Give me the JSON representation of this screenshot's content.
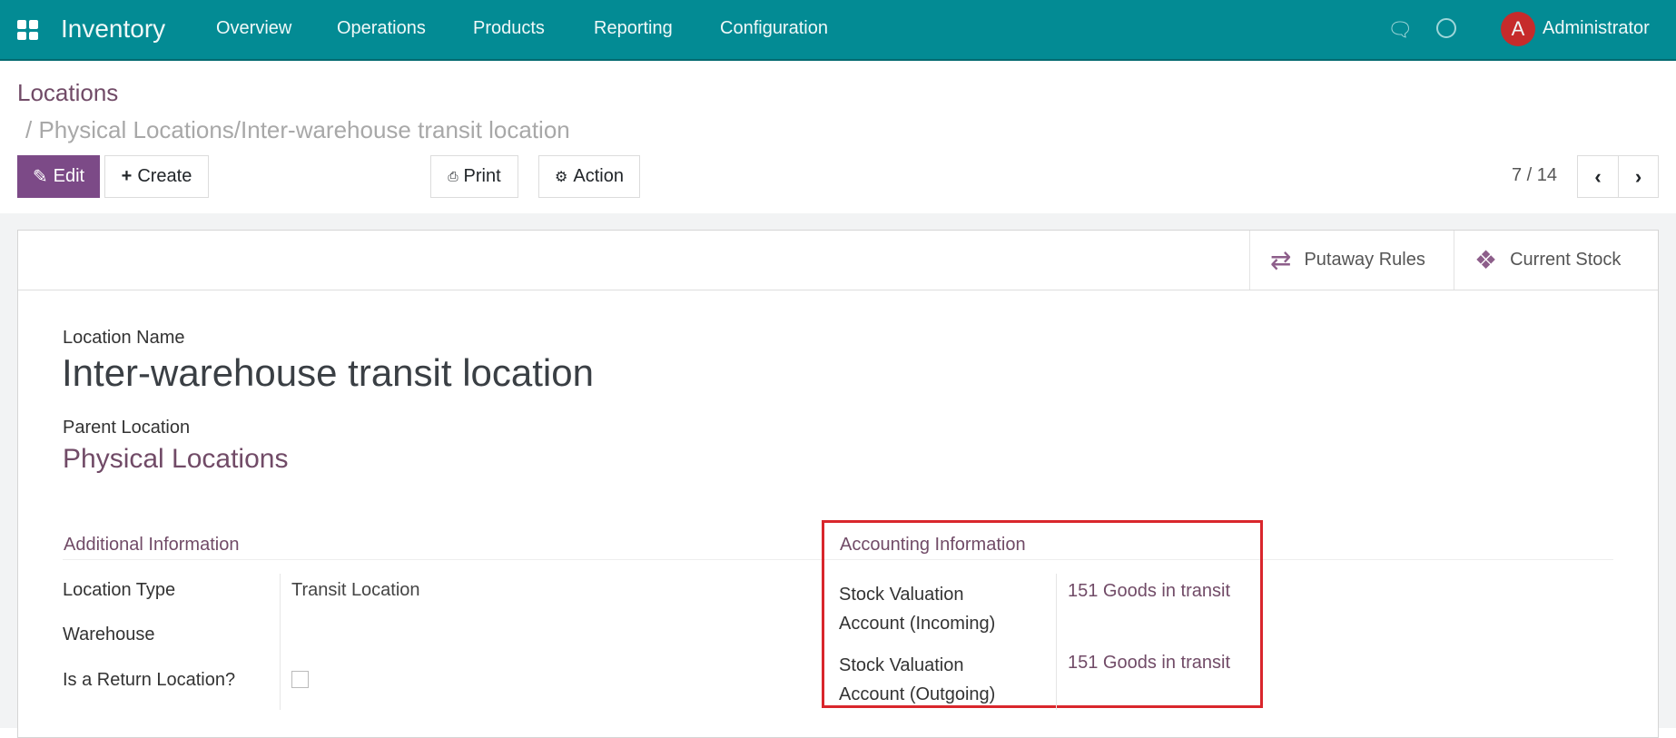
{
  "navbar": {
    "app_name": "Inventory",
    "menu": [
      "Overview",
      "Operations",
      "Products",
      "Reporting",
      "Configuration"
    ],
    "user": "Administrator",
    "avatar_letter": "A"
  },
  "breadcrumb": {
    "root": "Locations",
    "current": "/ Physical Locations/Inter-warehouse transit location"
  },
  "toolbar": {
    "edit": "Edit",
    "create": "Create",
    "print": "Print",
    "action": "Action",
    "pager": "7 / 14"
  },
  "smart_buttons": {
    "putaway": "Putaway Rules",
    "stock": "Current Stock"
  },
  "form": {
    "name_label": "Location Name",
    "name": "Inter-warehouse transit location",
    "parent_label": "Parent Location",
    "parent": "Physical Locations",
    "additional": {
      "title": "Additional Information",
      "location_type_label": "Location Type",
      "location_type": "Transit Location",
      "warehouse_label": "Warehouse",
      "return_label": "Is a Return Location?",
      "return_checked": false
    },
    "accounting": {
      "title": "Accounting Information",
      "in_label_1": "Stock Valuation",
      "in_label_2": "Account (Incoming)",
      "in_value": "151 Goods in transit",
      "out_label_1": "Stock Valuation",
      "out_label_2": "Account (Outgoing)",
      "out_value": "151 Goods in transit"
    }
  },
  "colors": {
    "navbar": "#038b94",
    "accent": "#714b67",
    "highlight": "#d9262c"
  }
}
